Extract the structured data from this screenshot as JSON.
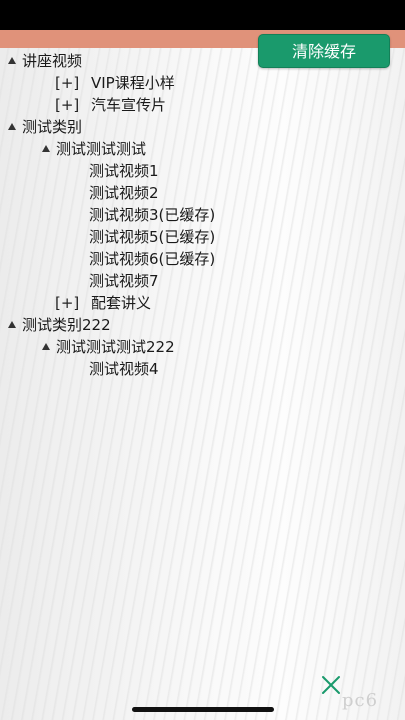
{
  "header": {
    "clear_cache_label": "清除缓存"
  },
  "tree": {
    "nodes": [
      {
        "type": "group",
        "label": "讲座视频"
      },
      {
        "type": "expand",
        "bracket": "[+]",
        "label": "VIP课程小样"
      },
      {
        "type": "expand",
        "bracket": "[+]",
        "label": "汽车宣传片"
      },
      {
        "type": "group",
        "label": "测试类别"
      },
      {
        "type": "subgroup",
        "label": "测试测试测试"
      },
      {
        "type": "item",
        "label": "测试视频1"
      },
      {
        "type": "item",
        "label": "测试视频2"
      },
      {
        "type": "item",
        "label": "测试视频3(已缓存)"
      },
      {
        "type": "item",
        "label": "测试视频5(已缓存)"
      },
      {
        "type": "item",
        "label": "测试视频6(已缓存)"
      },
      {
        "type": "item",
        "label": "测试视频7"
      },
      {
        "type": "expand",
        "bracket": "[+]",
        "label": "配套讲义"
      },
      {
        "type": "group",
        "label": "测试类别222"
      },
      {
        "type": "subgroup",
        "label": "测试测试测试222"
      },
      {
        "type": "item",
        "label": "测试视频4"
      }
    ]
  },
  "footer": {
    "close_icon": "close-icon",
    "watermark_text": "pc6"
  },
  "colors": {
    "status_bar": "#000000",
    "accent_strip": "#e0927a",
    "button_green": "#1a9a6c",
    "close_icon_green": "#1a9a6c"
  }
}
